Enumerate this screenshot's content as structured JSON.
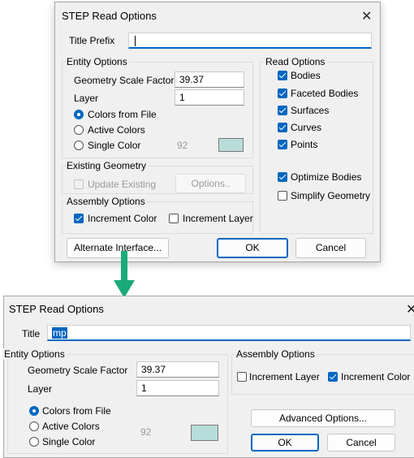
{
  "dialog1": {
    "title": "STEP Read Options",
    "title_prefix_label": "Title Prefix",
    "title_prefix_value": "",
    "entity_options": {
      "label": "Entity Options",
      "geometry_scale_factor_label": "Geometry Scale Factor",
      "geometry_scale_factor_value": "39.37",
      "layer_label": "Layer",
      "layer_value": "1",
      "colors_from_file": "Colors from File",
      "active_colors": "Active Colors",
      "single_color": "Single Color",
      "single_color_value": "92",
      "swatch_color": "#b7dcd9"
    },
    "read_options": {
      "label": "Read Options",
      "bodies": "Bodies",
      "faceted_bodies": "Faceted Bodies",
      "surfaces": "Surfaces",
      "curves": "Curves",
      "points": "Points",
      "optimize_bodies": "Optimize Bodies",
      "simplify_geometry": "Simplify Geometry"
    },
    "existing_geometry": {
      "label": "Existing Geometry",
      "update_existing": "Update Existing",
      "options_button": "Options.."
    },
    "assembly_options": {
      "label": "Assembly Options",
      "increment_color": "Increment Color",
      "increment_layer": "Increment Layer"
    },
    "buttons": {
      "alternate_interface": "Alternate Interface...",
      "ok": "OK",
      "cancel": "Cancel"
    }
  },
  "dialog2": {
    "title": "STEP Read Options",
    "title_label": "Title",
    "title_value": "mp",
    "entity_options": {
      "label": "Entity Options",
      "geometry_scale_factor_label": "Geometry Scale Factor",
      "geometry_scale_factor_value": "39.37",
      "layer_label": "Layer",
      "layer_value": "1",
      "colors_from_file": "Colors from File",
      "active_colors": "Active Colors",
      "single_color": "Single Color",
      "single_color_value": "92",
      "swatch_color": "#b7dcd9"
    },
    "assembly_options": {
      "label": "Assembly Options",
      "increment_layer": "Increment Layer",
      "increment_color": "Increment Color"
    },
    "buttons": {
      "advanced_options": "Advanced Options...",
      "ok": "OK",
      "cancel": "Cancel"
    }
  },
  "colors": {
    "accent": "#0067c0",
    "arrow": "#1aaa7a"
  }
}
